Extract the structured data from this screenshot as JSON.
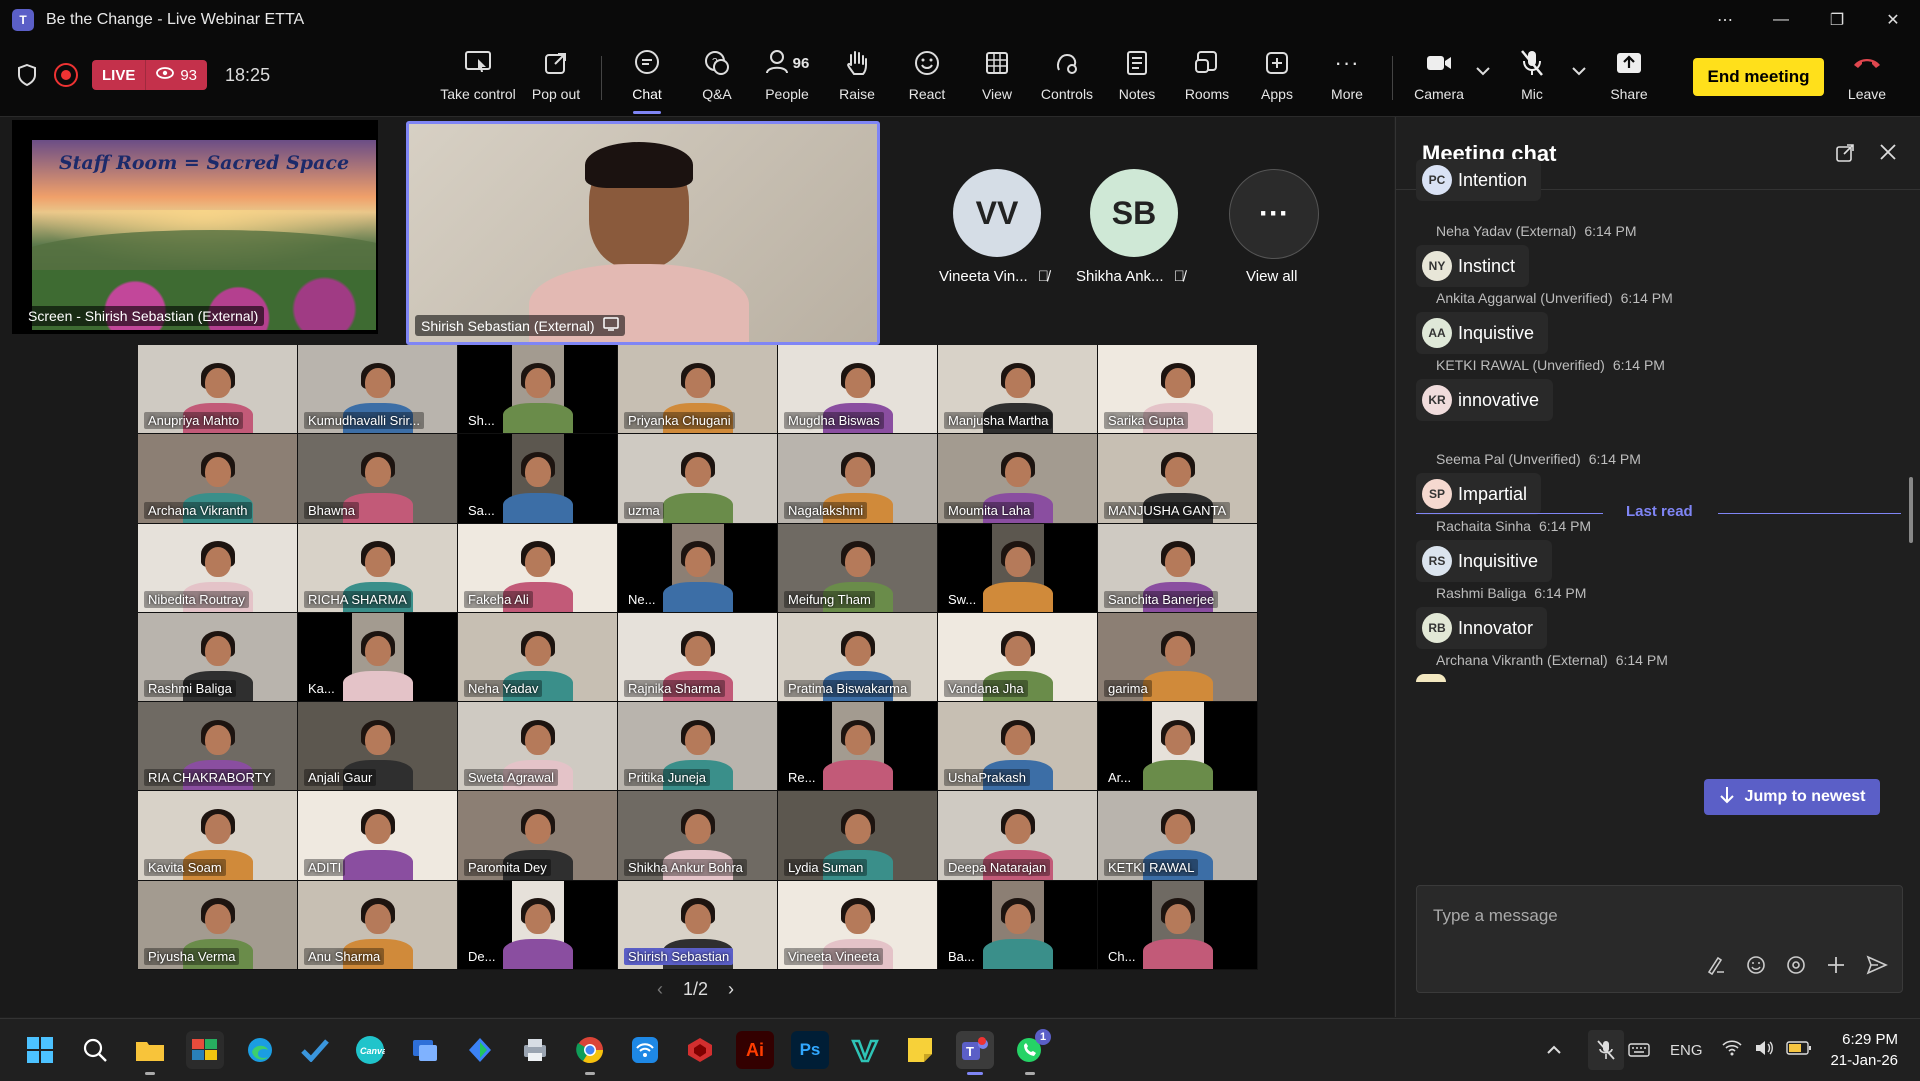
{
  "window": {
    "title": "Be the Change - Live Webinar ETTA"
  },
  "toolbar": {
    "live_label": "LIVE",
    "viewer_count": "93",
    "timer": "18:25",
    "buttons": [
      {
        "label": "Take control",
        "icon": "take-control-icon"
      },
      {
        "label": "Pop out",
        "icon": "pop-out-icon"
      },
      {
        "label": "Chat",
        "icon": "chat-icon"
      },
      {
        "label": "Q&A",
        "icon": "qa-icon"
      },
      {
        "label": "People",
        "icon": "people-icon",
        "count": "96"
      },
      {
        "label": "Raise",
        "icon": "raise-hand-icon"
      },
      {
        "label": "React",
        "icon": "react-icon"
      },
      {
        "label": "View",
        "icon": "view-icon"
      },
      {
        "label": "Controls",
        "icon": "controls-icon"
      },
      {
        "label": "Notes",
        "icon": "notes-icon"
      },
      {
        "label": "Rooms",
        "icon": "rooms-icon"
      },
      {
        "label": "Apps",
        "icon": "apps-icon"
      },
      {
        "label": "More",
        "icon": "more-icon"
      }
    ],
    "camera_label": "Camera",
    "mic_label": "Mic",
    "share_label": "Share",
    "end_meeting_label": "End meeting",
    "leave_label": "Leave",
    "accent_color": "#ffe01b"
  },
  "stage": {
    "screen_share_label": "Screen - Shirish Sebastian (External)",
    "slide_title": "Staff Room = Sacred Space",
    "speaker_label": "Shirish Sebastian (External)",
    "roster": [
      {
        "initials": "VV",
        "name": "Vineeta Vin...",
        "color": "#d5dde6"
      },
      {
        "initials": "SB",
        "name": "Shikha Ank...",
        "color": "#cfe8d6"
      }
    ],
    "view_all_label": "View all",
    "pager": "1/2"
  },
  "participants": [
    "Anupriya Mahto",
    "Kumudhavalli Srir...",
    "Sh...",
    "Priyanka Chugani",
    "Mugdha Biswas",
    "Manjusha Martha",
    "Sarika Gupta",
    "Archana Vikranth",
    "Bhawna",
    "Sa...",
    "uzma",
    "Nagalakshmi",
    "Moumita Laha",
    "MANJUSHA GANTA",
    "Nibedita Routray",
    "RICHA SHARMA",
    "Fakeha Ali",
    "Ne...",
    "Meifung Tham",
    "Sw...",
    "Sanchita Banerjee",
    "Rashmi Baliga",
    "Ka...",
    "Neha Yadav",
    "Rajnika Sharma",
    "Pratima Biswakarma",
    "Vandana Jha",
    "garima",
    "RIA CHAKRABORTY",
    "Anjali Gaur",
    "Sweta Agrawal",
    "Pritika Juneja",
    "Re...",
    "UshaPrakash",
    "Ar...",
    "Kavita Soam",
    "ADITI",
    "Paromita Dey",
    "Shikha Ankur Bohra",
    "Lydia Suman",
    "Deepa Natarajan",
    "KETKI RAWAL",
    "Piyusha Verma",
    "Anu Sharma",
    "De...",
    "Shirish Sebastian",
    "Vineeta Vineeta",
    "Ba...",
    "Ch..."
  ],
  "chat": {
    "title": "Meeting chat",
    "messages": [
      {
        "author": "",
        "time": "",
        "initials": "PC",
        "text": "Intention",
        "color": "#d9e2f5"
      },
      {
        "author": "Neha Yadav (External)",
        "time": "6:14 PM",
        "initials": "NY",
        "text": "Instinct",
        "color": "#e8e6d8"
      },
      {
        "author": "Ankita Aggarwal (Unverified)",
        "time": "6:14 PM",
        "initials": "AA",
        "text": "Inquistive",
        "color": "#dfe8d8"
      },
      {
        "author": "KETKI RAWAL (Unverified)",
        "time": "6:14 PM",
        "initials": "KR",
        "text": "innovative",
        "color": "#f0dcdc"
      },
      {
        "author": "Seema Pal (Unverified)",
        "time": "6:14 PM",
        "initials": "SP",
        "text": "Impartial",
        "color": "#f5d9d0"
      },
      {
        "author": "Rachaita Sinha",
        "time": "6:14 PM",
        "initials": "RS",
        "text": "Inquisitive",
        "color": "#dbe4ee"
      },
      {
        "author": "Rashmi Baliga",
        "time": "6:14 PM",
        "initials": "RB",
        "text": "Innovator",
        "color": "#e2e8d6"
      },
      {
        "author": "Archana Vikranth (External)",
        "time": "6:14 PM",
        "initials": "",
        "text": "",
        "color": "#f3e8c0"
      }
    ],
    "last_read_label": "Last read",
    "jump_label": "Jump to newest",
    "compose_placeholder": "Type a message"
  },
  "taskbar": {
    "language": "ENG",
    "time": "6:29 PM",
    "date": "21-Jan-26",
    "whatsapp_badge": "1"
  }
}
